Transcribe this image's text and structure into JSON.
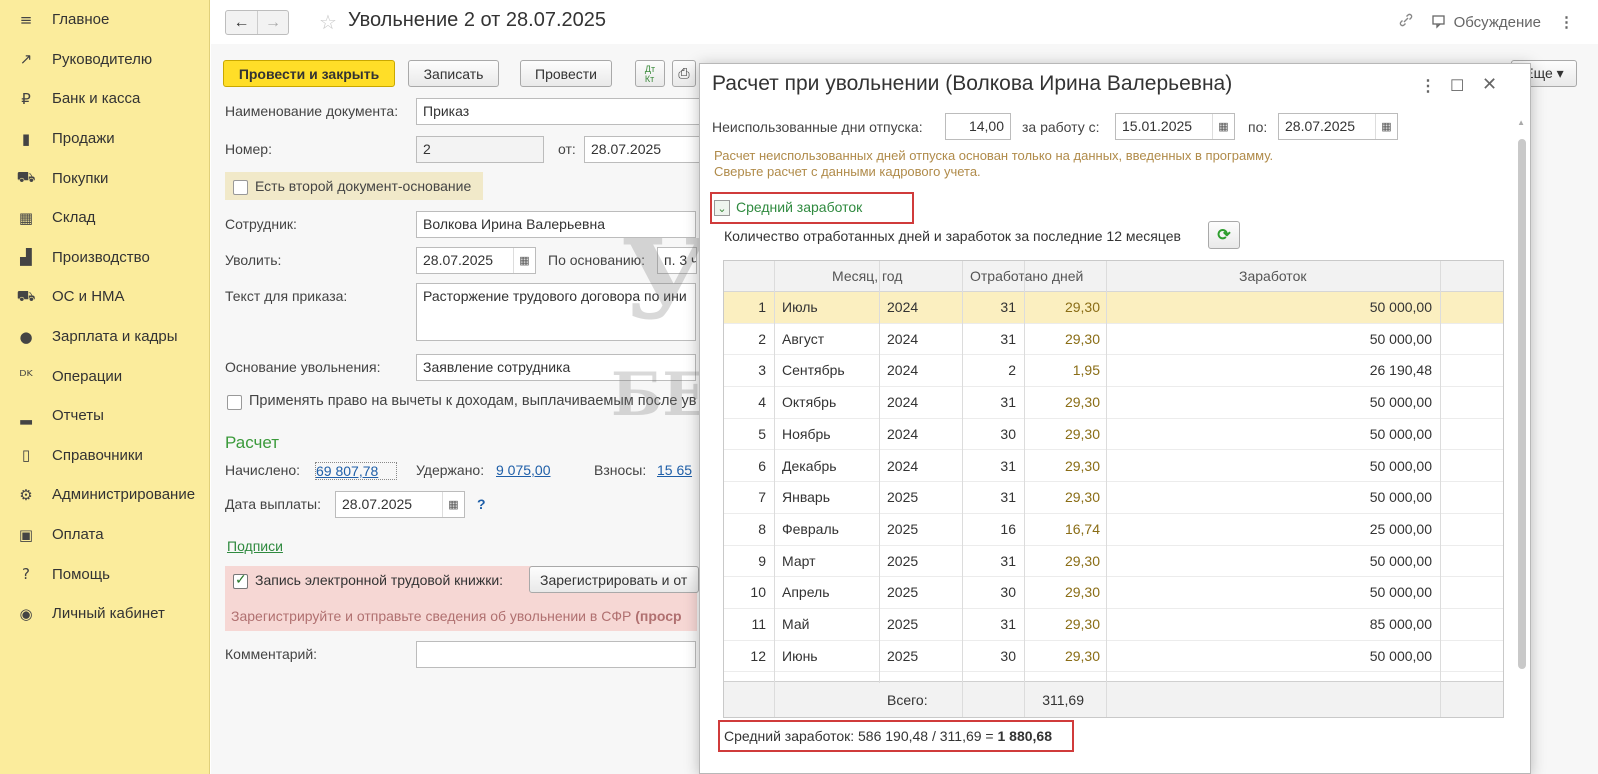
{
  "sidebar": {
    "items": [
      {
        "label": "Главное",
        "icon": "≡"
      },
      {
        "label": "Руководителю",
        "icon": "↗"
      },
      {
        "label": "Банк и касса",
        "icon": "₽"
      },
      {
        "label": "Продажи",
        "icon": "▮"
      },
      {
        "label": "Покупки",
        "icon": "⛟"
      },
      {
        "label": "Склад",
        "icon": "▦"
      },
      {
        "label": "Производство",
        "icon": "▟"
      },
      {
        "label": "ОС и НМА",
        "icon": "⛟"
      },
      {
        "label": "Зарплата и кадры",
        "icon": "●"
      },
      {
        "label": "Операции",
        "icon": "ᴰᴷ"
      },
      {
        "label": "Отчеты",
        "icon": "▂"
      },
      {
        "label": "Справочники",
        "icon": "▯"
      },
      {
        "label": "Администрирование",
        "icon": "⚙"
      },
      {
        "label": "Оплата",
        "icon": "▣"
      },
      {
        "label": "Помощь",
        "icon": "?"
      },
      {
        "label": "Личный кабинет",
        "icon": "◉"
      }
    ]
  },
  "header": {
    "title": "Увольнение 2 от 28.07.2025",
    "back": "←",
    "forward": "→",
    "star": "☆",
    "link_icon": "🔗",
    "discussion": "Обсуждение",
    "more": "⋮"
  },
  "toolbar": {
    "post_close": "Провести и закрыть",
    "save": "Записать",
    "post": "Провести",
    "more": "Еще ▾"
  },
  "form": {
    "doc_name_label": "Наименование документа:",
    "doc_name_value": "Приказ",
    "number_label": "Номер:",
    "number_value": "2",
    "from_label": "от:",
    "from_value": "28.07.2025",
    "second_doc_label": "Есть второй документ-основание",
    "employee_label": "Сотрудник:",
    "employee_value": "Волкова Ирина Валерьевна",
    "dismiss_label": "Уволить:",
    "dismiss_value": "28.07.2025",
    "basis_label": "По основанию:",
    "basis_value": "п. 3 ч",
    "order_text_label": "Текст для приказа:",
    "order_text_value": "Расторжение трудового договора по ини",
    "reason_label": "Основание увольнения:",
    "reason_value": "Заявление сотрудника",
    "deductions_label": "Применять право на вычеты к доходам, выплачиваемым после ув",
    "calc_title": "Расчет",
    "accrued_label": "Начислено:",
    "accrued_value": "69 807,78",
    "withheld_label": "Удержано:",
    "withheld_value": "9 075,00",
    "contrib_label": "Взносы:",
    "contrib_value": "15 65",
    "pay_date_label": "Дата выплаты:",
    "pay_date_value": "28.07.2025",
    "help": "?",
    "signatures": "Подписи",
    "etk_label": "Запись электронной трудовой книжки:",
    "etk_button": "Зарегистрировать и от",
    "etk_warning": "Зарегистрируйте и отправьте сведения об увольнении в СФР",
    "etk_warning_bold": "(проср",
    "comment_label": "Комментарий:"
  },
  "watermark": {
    "line1": "УЧЕТ",
    "line2": "БЕЗ ЗАБОТ"
  },
  "dialog": {
    "title": "Расчет при увольнении (Волкова Ирина Валерьевна)",
    "unused_days_label": "Неиспользованные дни отпуска:",
    "unused_days_value": "14,00",
    "period_from_label": "за работу с:",
    "period_from_value": "15.01.2025",
    "period_to_label": "по:",
    "period_to_value": "28.07.2025",
    "note_line1": "Расчет неиспользованных дней отпуска основан только на данных, введенных в программу.",
    "note_line2": "Сверьте расчет с данными кадрового учета.",
    "section_label": "Средний заработок",
    "grid_caption": "Количество отработанных дней и заработок за последние 12 месяцев",
    "col_month": "Месяц, год",
    "col_days": "Отработано дней",
    "col_earnings": "Заработок",
    "rows": [
      {
        "n": "1",
        "month": "Июль",
        "year": "2024",
        "days": "31",
        "calc": "29,30",
        "earn": "50 000,00"
      },
      {
        "n": "2",
        "month": "Август",
        "year": "2024",
        "days": "31",
        "calc": "29,30",
        "earn": "50 000,00"
      },
      {
        "n": "3",
        "month": "Сентябрь",
        "year": "2024",
        "days": "2",
        "calc": "1,95",
        "earn": "26 190,48"
      },
      {
        "n": "4",
        "month": "Октябрь",
        "year": "2024",
        "days": "31",
        "calc": "29,30",
        "earn": "50 000,00"
      },
      {
        "n": "5",
        "month": "Ноябрь",
        "year": "2024",
        "days": "30",
        "calc": "29,30",
        "earn": "50 000,00"
      },
      {
        "n": "6",
        "month": "Декабрь",
        "year": "2024",
        "days": "31",
        "calc": "29,30",
        "earn": "50 000,00"
      },
      {
        "n": "7",
        "month": "Январь",
        "year": "2025",
        "days": "31",
        "calc": "29,30",
        "earn": "50 000,00"
      },
      {
        "n": "8",
        "month": "Февраль",
        "year": "2025",
        "days": "16",
        "calc": "16,74",
        "earn": "25 000,00"
      },
      {
        "n": "9",
        "month": "Март",
        "year": "2025",
        "days": "31",
        "calc": "29,30",
        "earn": "50 000,00"
      },
      {
        "n": "10",
        "month": "Апрель",
        "year": "2025",
        "days": "30",
        "calc": "29,30",
        "earn": "50 000,00"
      },
      {
        "n": "11",
        "month": "Май",
        "year": "2025",
        "days": "31",
        "calc": "29,30",
        "earn": "85 000,00"
      },
      {
        "n": "12",
        "month": "Июнь",
        "year": "2025",
        "days": "30",
        "calc": "29,30",
        "earn": "50 000,00"
      }
    ],
    "total_label": "Всего:",
    "total_value": "311,69",
    "avg_formula": "Средний заработок: 586 190,48 / 311,69 = ",
    "avg_result": "1 880,68"
  }
}
